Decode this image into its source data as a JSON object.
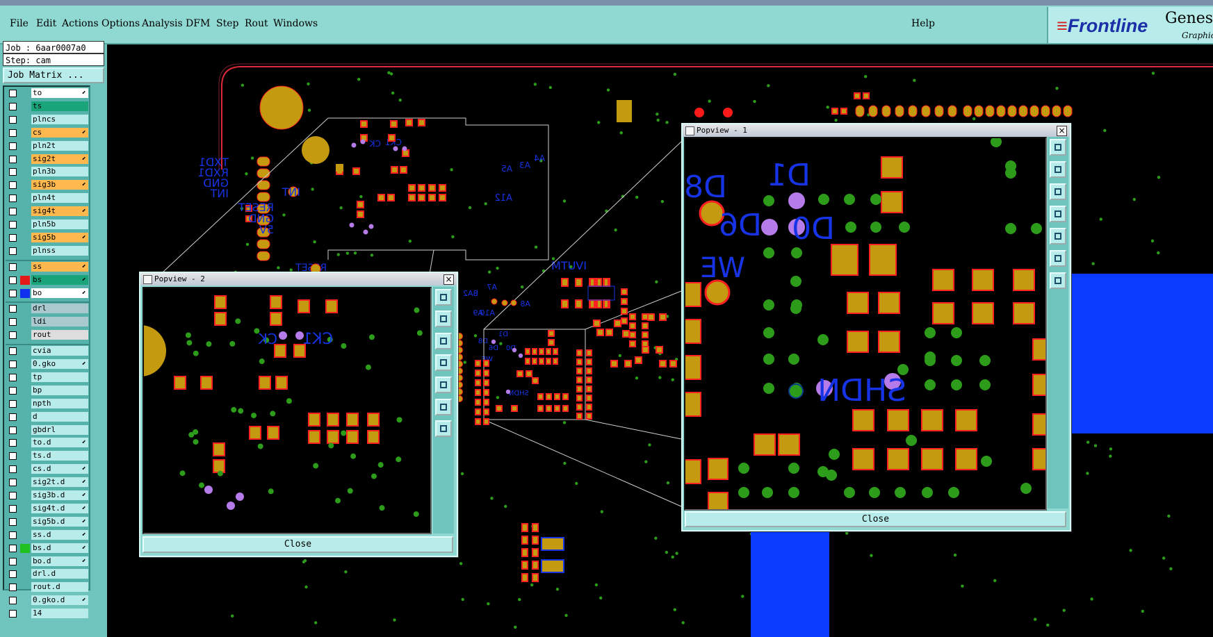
{
  "menu": [
    "File",
    "Edit",
    "Actions",
    "Options",
    "Analysis",
    "DFM",
    "Step",
    "Rout",
    "Windows"
  ],
  "help": "Help",
  "brand": {
    "logo": "Frontline",
    "product": "Genesi",
    "tagline": "Graphic"
  },
  "job": {
    "job_text": "Job : 6aar0007a0",
    "step_text": "Step: cam",
    "matrix_label": "Job Matrix ..."
  },
  "layers": [
    {
      "name": "to",
      "color": "#ffffff",
      "bg": "#ffffff",
      "arrow": true
    },
    {
      "name": "ts",
      "color": "#000000",
      "bg": "#19a47a",
      "arrow": false
    },
    {
      "name": "plncs",
      "color": "#000000",
      "bg": "#b7ecea",
      "arrow": false
    },
    {
      "name": "cs",
      "color": "#000000",
      "bg": "#ffb84d",
      "arrow": true
    },
    {
      "name": "pln2t",
      "color": "#000000",
      "bg": "#b7ecea",
      "arrow": false
    },
    {
      "name": "sig2t",
      "color": "#000000",
      "bg": "#ffb84d",
      "arrow": true
    },
    {
      "name": "pln3b",
      "color": "#000000",
      "bg": "#b7ecea",
      "arrow": false
    },
    {
      "name": "sig3b",
      "color": "#000000",
      "bg": "#ffb84d",
      "arrow": true
    },
    {
      "name": "pln4t",
      "color": "#000000",
      "bg": "#b7ecea",
      "arrow": false
    },
    {
      "name": "sig4t",
      "color": "#000000",
      "bg": "#ffb84d",
      "arrow": true
    },
    {
      "name": "pln5b",
      "color": "#000000",
      "bg": "#b7ecea",
      "arrow": false
    },
    {
      "name": "sig5b",
      "color": "#000000",
      "bg": "#ffb84d",
      "arrow": true
    },
    {
      "name": "plnss",
      "color": "#000000",
      "bg": "#b7ecea",
      "arrow": false
    },
    {
      "name": "ss",
      "color": "#000000",
      "bg": "#ffb84d",
      "arrow": true
    },
    {
      "name": "bs",
      "color": "#e31a1a",
      "bg": "#19a47a",
      "arrow": true
    },
    {
      "name": "bo",
      "color": "#1030f0",
      "bg": "#ffffff",
      "arrow": true
    },
    {
      "name": "drl",
      "color": "#000000",
      "bg": "#a9c9cf",
      "arrow": false
    },
    {
      "name": "ldi",
      "color": "#000000",
      "bg": "#a9c9cf",
      "arrow": false
    },
    {
      "name": "rout",
      "color": "#000000",
      "bg": "#dddddd",
      "arrow": false
    },
    {
      "name": "cvia",
      "color": "#000000",
      "bg": "#b7ecea",
      "arrow": false
    },
    {
      "name": "0.gko",
      "color": "#000000",
      "bg": "#b7ecea",
      "arrow": true
    },
    {
      "name": "tp",
      "color": "#000000",
      "bg": "#b7ecea",
      "arrow": false
    },
    {
      "name": "bp",
      "color": "#000000",
      "bg": "#b7ecea",
      "arrow": false
    },
    {
      "name": "npth",
      "color": "#000000",
      "bg": "#b7ecea",
      "arrow": false
    },
    {
      "name": "d",
      "color": "#000000",
      "bg": "#b7ecea",
      "arrow": false
    },
    {
      "name": "gbdrl",
      "color": "#000000",
      "bg": "#b7ecea",
      "arrow": false
    },
    {
      "name": "to.d",
      "color": "#000000",
      "bg": "#b7ecea",
      "arrow": true
    },
    {
      "name": "ts.d",
      "color": "#000000",
      "bg": "#b7ecea",
      "arrow": false
    },
    {
      "name": "cs.d",
      "color": "#000000",
      "bg": "#b7ecea",
      "arrow": true
    },
    {
      "name": "sig2t.d",
      "color": "#000000",
      "bg": "#b7ecea",
      "arrow": true
    },
    {
      "name": "sig3b.d",
      "color": "#000000",
      "bg": "#b7ecea",
      "arrow": true
    },
    {
      "name": "sig4t.d",
      "color": "#000000",
      "bg": "#b7ecea",
      "arrow": true
    },
    {
      "name": "sig5b.d",
      "color": "#000000",
      "bg": "#b7ecea",
      "arrow": true
    },
    {
      "name": "ss.d",
      "color": "#000000",
      "bg": "#b7ecea",
      "arrow": true
    },
    {
      "name": "bs.d",
      "color": "#20c020",
      "bg": "#b7ecea",
      "arrow": true
    },
    {
      "name": "bo.d",
      "color": "#000000",
      "bg": "#b7ecea",
      "arrow": true
    },
    {
      "name": "drl.d",
      "color": "#000000",
      "bg": "#b7ecea",
      "arrow": false
    },
    {
      "name": "rout.d",
      "color": "#000000",
      "bg": "#b7ecea",
      "arrow": false
    },
    {
      "name": "0.gko.d",
      "color": "#000000",
      "bg": "#b7ecea",
      "arrow": true
    },
    {
      "name": "14",
      "color": "#000000",
      "bg": "#b7ecea",
      "arrow": false
    }
  ],
  "pcb_labels": {
    "main": [
      "TXD1",
      "RXD1",
      "GND",
      "INT",
      "INT",
      "RESET",
      "GND",
      "5V",
      "CK",
      "CK1",
      "A5",
      "A3",
      "A4",
      "A12",
      "RESET",
      "IVUTM",
      "BA2",
      "A7",
      "A8",
      "A9",
      "A10",
      "D1",
      "D8",
      "D6",
      "D0",
      "WE",
      "SHDN"
    ],
    "popup1": [
      "D8",
      "D1",
      "D6",
      "D0",
      "WE",
      "SHDN"
    ],
    "popup2": [
      "CK",
      "CK1"
    ]
  },
  "popup1": {
    "title": "Popview - 1",
    "close_label": "Close"
  },
  "popup2": {
    "title": "Popview - 2",
    "close_label": "Close"
  },
  "colors": {
    "pad_fill": "#c49a10",
    "pad_border": "#ff2020",
    "via": "#2c9c1a",
    "label": "#1633e6",
    "outline": "#e0283a",
    "purple": "#b57be8",
    "blue_plane": "#0a3cff"
  }
}
